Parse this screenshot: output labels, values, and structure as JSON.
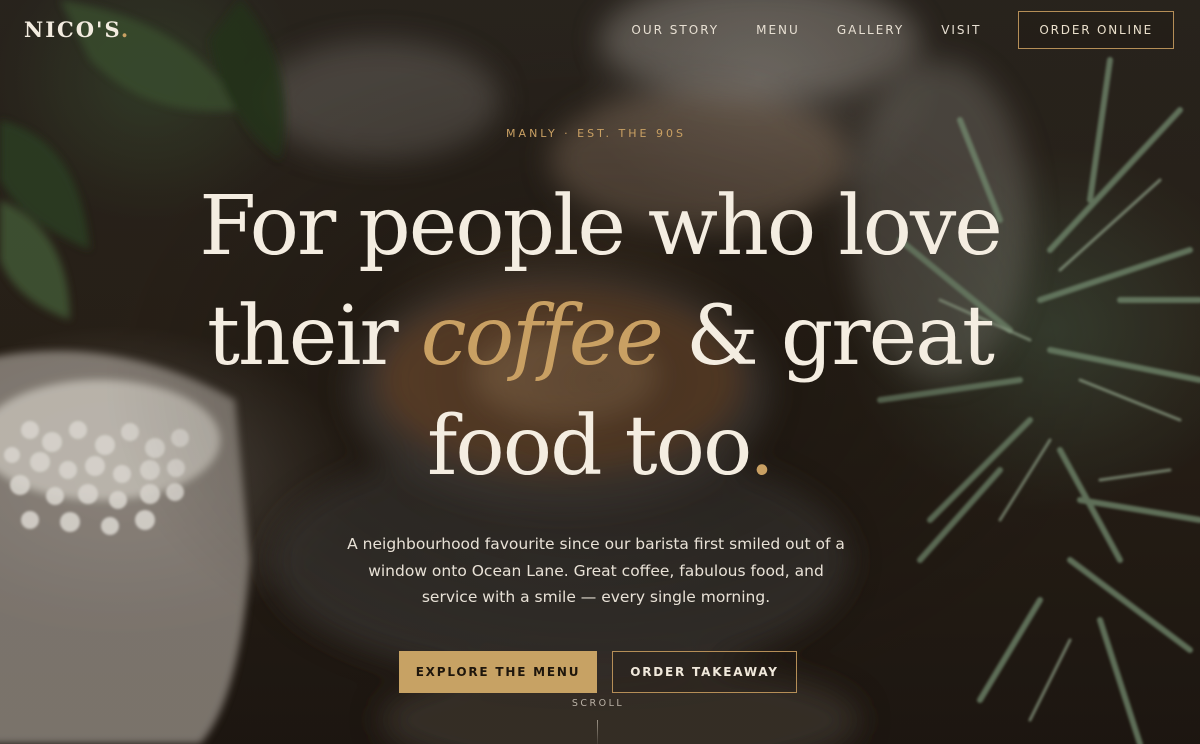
{
  "brand": {
    "name": "NICO'S",
    "dot": "."
  },
  "nav": {
    "links": [
      "OUR STORY",
      "MENU",
      "GALLERY",
      "VISIT"
    ],
    "cta": "ORDER ONLINE"
  },
  "hero": {
    "eyebrow": "MANLY · EST. THE 90S",
    "headline": {
      "line1": "For people who love",
      "line2_before": "their ",
      "line2_accent": "coffee",
      "line2_after": " & great",
      "line3": "food too",
      "period": "."
    },
    "lede": {
      "line1": "A neighbourhood favourite since our barista first smiled out of a",
      "line2": "window onto Ocean Lane. Great coffee, fabulous food, and",
      "line3": "service with a smile — every single morning."
    },
    "primary_button": "EXPLORE THE MENU",
    "secondary_button": "ORDER TAKEAWAY",
    "scroll": "SCROLL"
  },
  "colors": {
    "accent": "#c9a063",
    "text": "#f4ede1",
    "background": "#2a2219"
  }
}
